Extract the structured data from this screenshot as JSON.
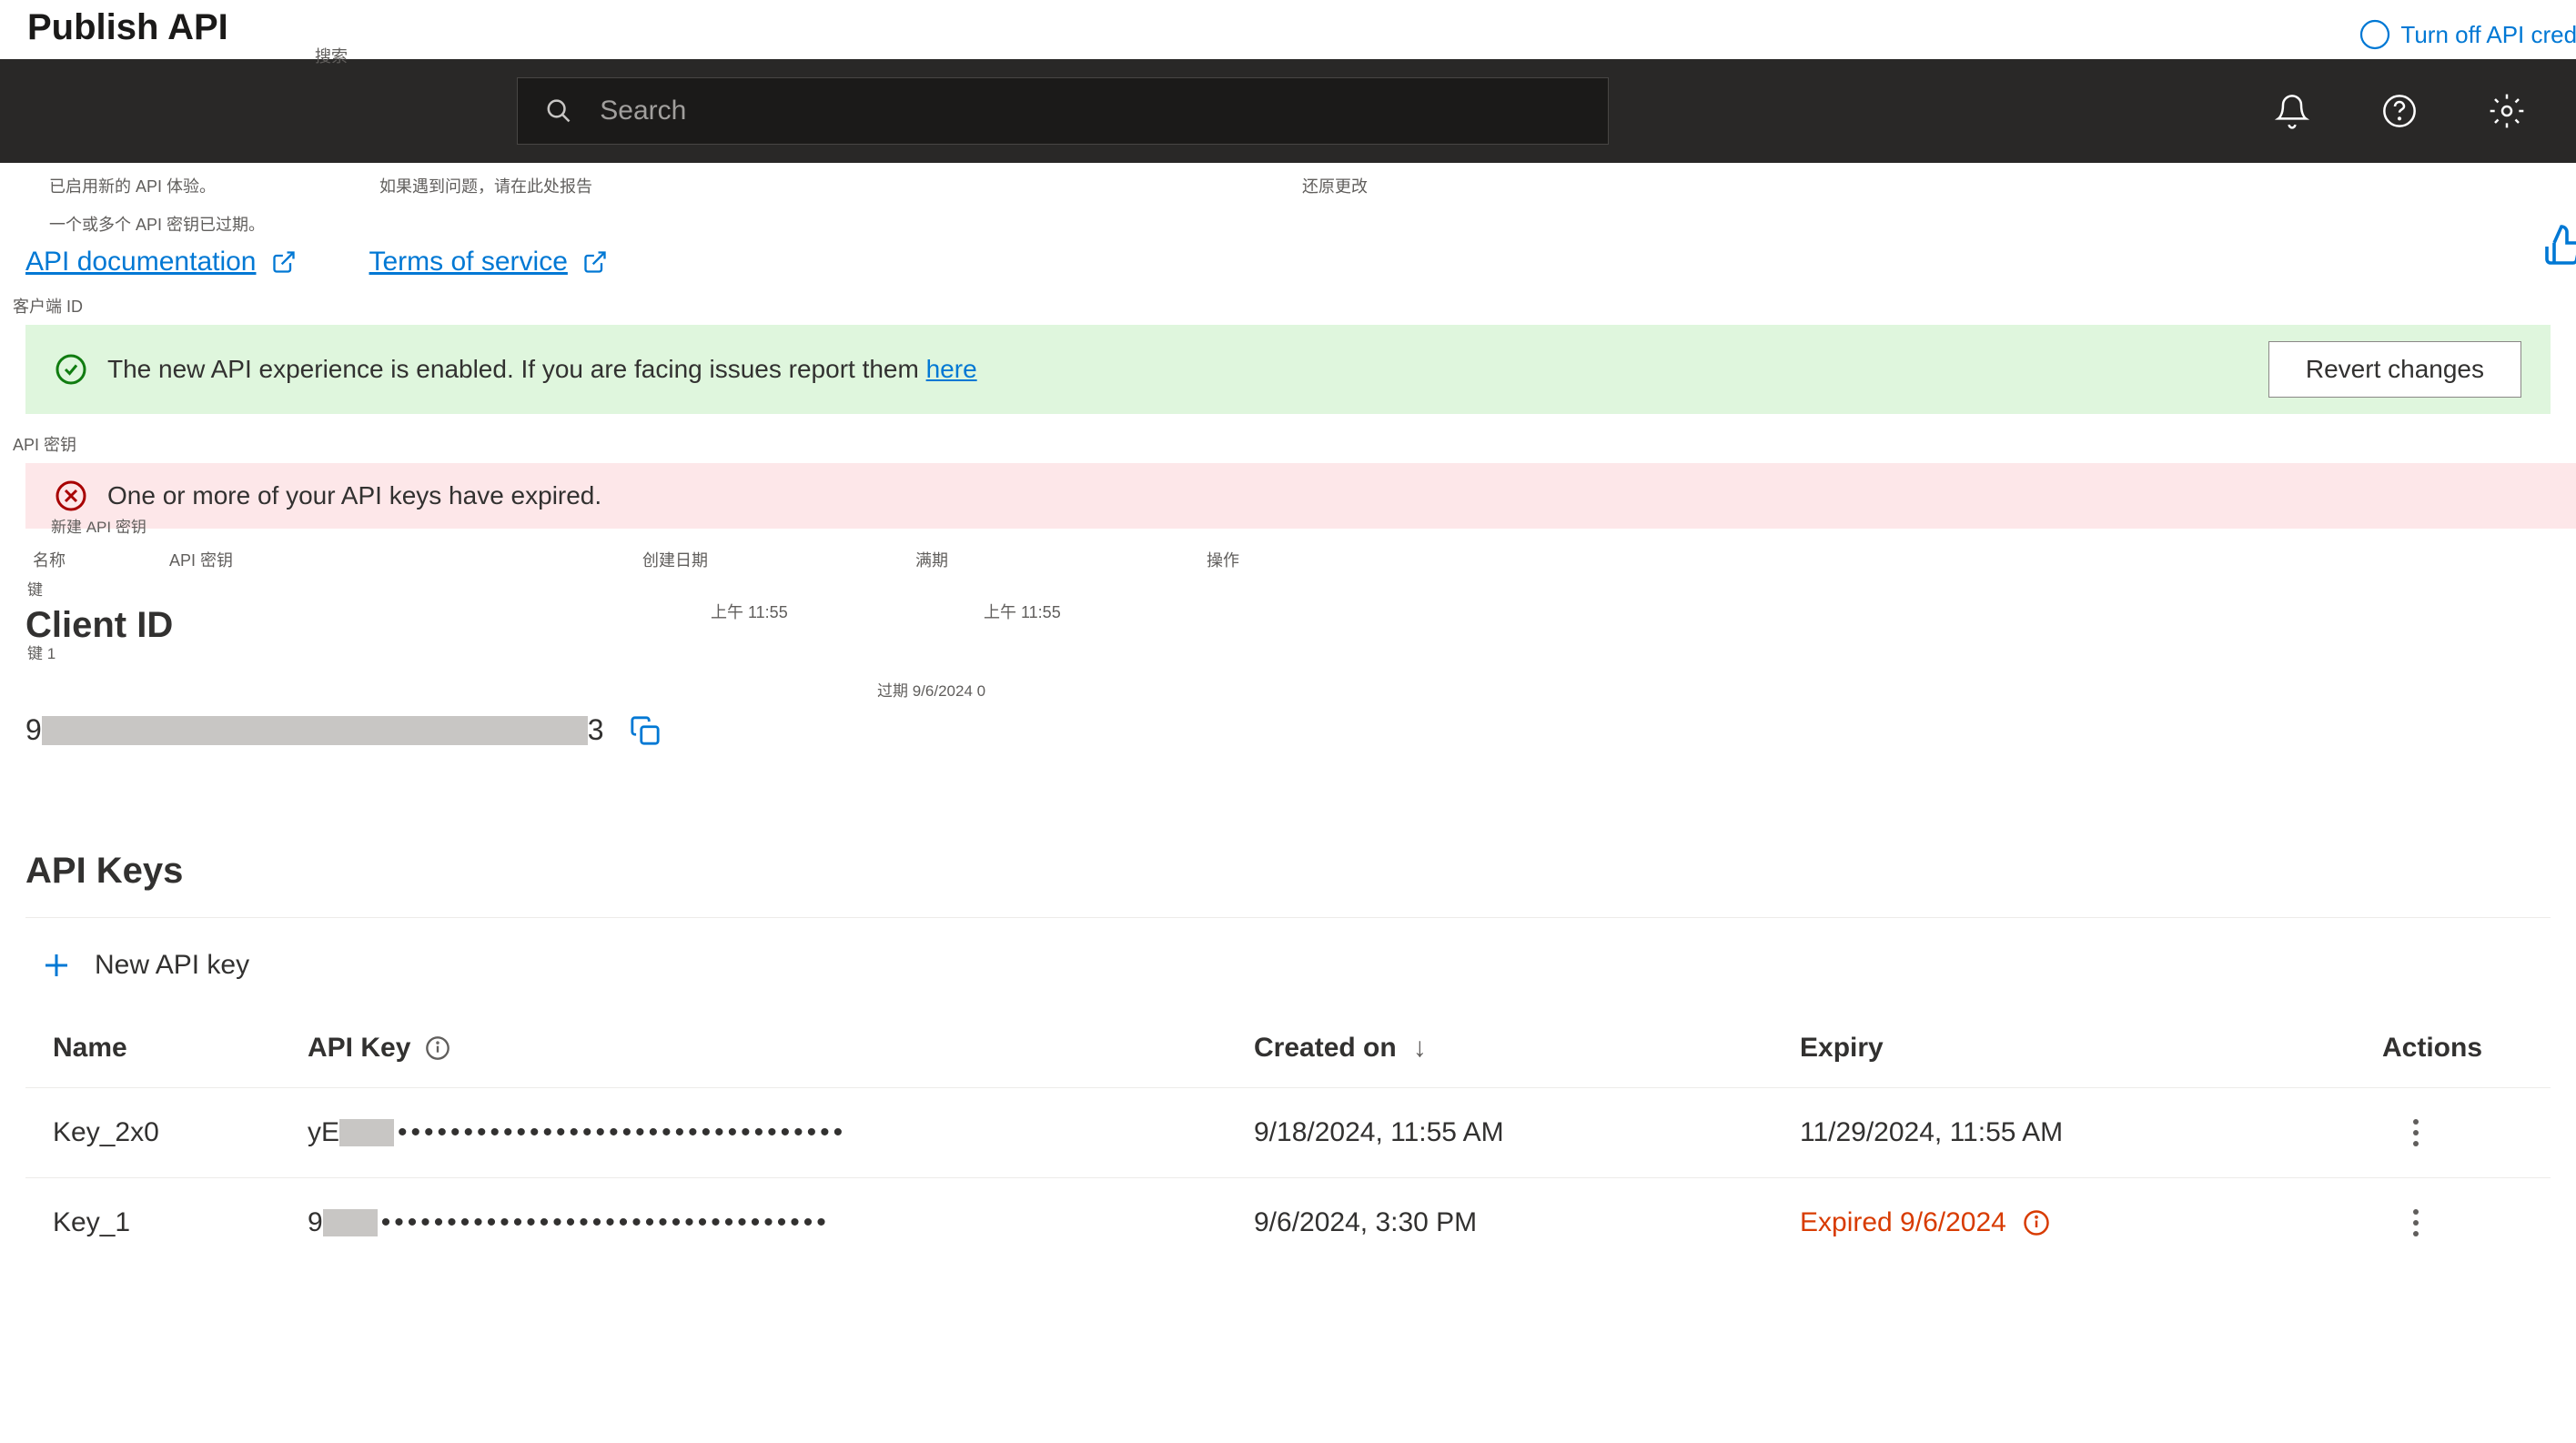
{
  "page": {
    "title_partial": "Publish API",
    "top_link_partial": "Turn off API creden"
  },
  "topbar": {
    "search_placeholder": "Search",
    "search_small_label": "搜索"
  },
  "chinese_row": {
    "item1": "已启用新的 API 体验。",
    "item2": "如果遇到问题，请在此处报告",
    "item3": "还原更改"
  },
  "chinese_row2": "一个或多个 API 密钥已过期。",
  "links": {
    "api_doc": "API documentation",
    "terms": "Terms of service"
  },
  "small_labels": {
    "client_id_cn": "客户端 ID",
    "api_key_cn": "API 密钥",
    "new_api_key_cn": "新建 API 密钥"
  },
  "banners": {
    "success_text": "The new API experience is enabled. If you are facing issues report them ",
    "success_link": "here",
    "revert_button": "Revert changes",
    "error_text": "One or more of your API keys have expired."
  },
  "small_table": {
    "headers": {
      "name": "名称",
      "api_key": "API 密钥",
      "created": "创建日期",
      "expiry": "满期",
      "actions": "操作"
    },
    "row": {
      "t1": "上午 11:55",
      "t2": "上午 11:55",
      "key_label": "键",
      "key1_label": "键 1",
      "expired_label": "过期 9/6/2024 0"
    }
  },
  "client_id": {
    "heading": "Client ID",
    "prefix": "9",
    "suffix": "3"
  },
  "api_keys": {
    "heading": "API Keys",
    "new_key_label": "New API key",
    "table": {
      "headers": {
        "name": "Name",
        "api_key": "API Key",
        "created": "Created on",
        "expiry": "Expiry",
        "actions": "Actions"
      },
      "rows": [
        {
          "name": "Key_2x0",
          "prefix": "yE",
          "dots": "••••••••••••••••••••••••••••••••••",
          "created": "9/18/2024, 11:55 AM",
          "expiry": "11/29/2024, 11:55 AM",
          "expired": false
        },
        {
          "name": "Key_1",
          "prefix": "9",
          "dots": "••••••••••••••••••••••••••••••••••",
          "created": "9/6/2024, 3:30 PM",
          "expiry": "Expired 9/6/2024",
          "expired": true
        }
      ]
    }
  }
}
